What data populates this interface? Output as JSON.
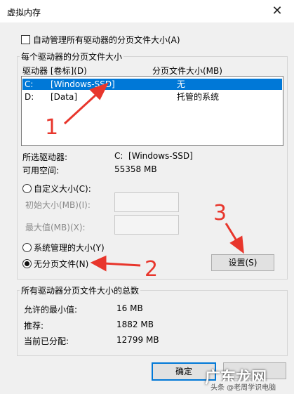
{
  "window": {
    "title": "虚拟内存",
    "close_glyph": "✕"
  },
  "auto_manage": {
    "label": "自动管理所有驱动器的分页文件大小(A)"
  },
  "drives_group": {
    "title": "每个驱动器的分页文件大小",
    "header_drive": "驱动器 [卷标](D)",
    "header_size": "分页文件大小(MB)",
    "rows": [
      {
        "letter": "C:",
        "label": "[Windows-SSD]",
        "size": "无"
      },
      {
        "letter": "D:",
        "label": "[Data]",
        "size": "托管的系统"
      }
    ]
  },
  "selected": {
    "drive_label": "所选驱动器:",
    "drive_value": "C:  [Windows-SSD]",
    "space_label": "可用空间:",
    "space_value": "55358 MB"
  },
  "custom": {
    "label": "自定义大小(C):",
    "initial_label": "初始大小(MB)(I):",
    "max_label": "最大值(MB)(X):"
  },
  "system_managed": {
    "label": "系统管理的大小(Y)"
  },
  "no_paging": {
    "label": "无分页文件(N)"
  },
  "set_button": {
    "label": "设置(S)"
  },
  "totals": {
    "title": "所有驱动器分页文件大小的总数",
    "min_label": "允许的最小值:",
    "min_value": "16 MB",
    "rec_label": "推荐:",
    "rec_value": "1882 MB",
    "cur_label": "当前已分配:",
    "cur_value": "12799 MB"
  },
  "ok_button": {
    "label": "确定"
  },
  "annotations": {
    "n1": "1",
    "n2": "2",
    "n3": "3"
  },
  "watermark": {
    "brand": "广东龙网",
    "source": "头条 @老周学识电脑"
  }
}
